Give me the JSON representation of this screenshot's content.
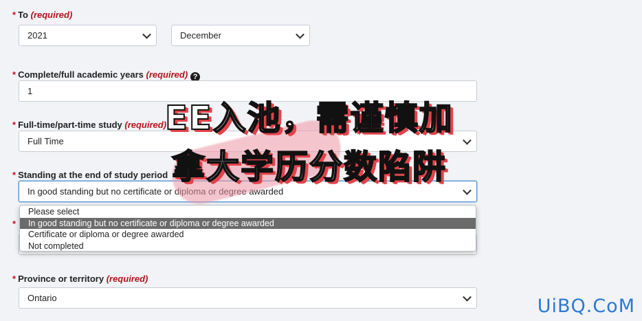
{
  "to": {
    "asterisk": "*",
    "label": "To",
    "required": "(required)",
    "year_value": "2021",
    "month_value": "December"
  },
  "years": {
    "asterisk": "*",
    "label": "Complete/full academic years",
    "required": "(required)",
    "help": "?",
    "value": "1"
  },
  "study": {
    "asterisk": "*",
    "label": "Full-time/part-time study",
    "required": "(required)",
    "value": "Full Time"
  },
  "standing": {
    "asterisk": "*",
    "label": "Standing at the end of study period",
    "value": "In good standing but no certificate or diploma or degree awarded",
    "options": [
      "Please select",
      "In good standing but no certificate or diploma or degree awarded",
      "Certificate or diploma or degree awarded",
      "Not completed"
    ],
    "selected_index": 1
  },
  "hidden_asterisk": "*",
  "province": {
    "asterisk": "*",
    "label": "Province or territory",
    "required": "(required)",
    "value": "Ontario"
  },
  "overlay": {
    "line1": "EE入池，需谨慎加",
    "line2": "拿大学历分数陷阱",
    "accent_color": "#e2434b"
  },
  "watermark": "UiBQ.CoM"
}
